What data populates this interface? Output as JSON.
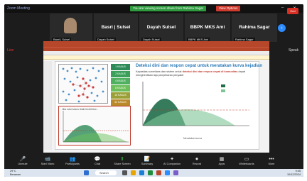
{
  "zoom": {
    "app_title": "Zoom Meeting",
    "share_banner": "You are viewing screen share from Rahima Sagar",
    "view_options": "View Options",
    "participants": [
      {
        "name": "Basri | Sulsel",
        "label": "Basri | Sulsel"
      },
      {
        "name": "Dayah Sulsel",
        "label": "Dayah Sulsel"
      },
      {
        "name": "BBPK MKS Ami",
        "label": "BBPK MKS Ami"
      },
      {
        "name": "Rahima Sagar",
        "label": "Rahima Sagar"
      }
    ],
    "side_labels": {
      "left": "Live",
      "right": "Speak"
    }
  },
  "presentation": {
    "headline": "Deteksi dini dan respon cepat untuk meratakan kurva kejadian",
    "subtext_pre": "Kapasitas surveilans dan sistem untuk ",
    "subtext_bold": "deteksi dini dan respon cepat di komunitas",
    "subtext_post": " dapat menghentikan laju penyebaran penyakit",
    "bars": [
      {
        "label": "1 KASUS",
        "color": "#2e8b57"
      },
      {
        "label": "2 KASUS",
        "color": "#3aa05a"
      },
      {
        "label": "4 KASUS",
        "color": "#4fb060"
      },
      {
        "label": "8 KASUS",
        "color": "#6cbf5a"
      },
      {
        "label": "16 KASUS",
        "color": "#9aa035"
      },
      {
        "label": "32 KASUS",
        "color": "#b9892a"
      },
      {
        "label": "64 KASUS",
        "color": "#c6622a"
      },
      {
        "label": "128 KASUS",
        "color": "#c03a2b"
      }
    ],
    "note_left": "Jika satu kasus tidak terdeteksi...",
    "note_bottom": "Meratakan kurva"
  },
  "controls": [
    {
      "icon": "mic-icon",
      "glyph": "🎤",
      "label": "Unmute"
    },
    {
      "icon": "video-icon",
      "glyph": "📹",
      "label": "Start Video"
    },
    {
      "icon": "participants-icon",
      "glyph": "👥",
      "label": "Participants"
    },
    {
      "icon": "chat-icon",
      "glyph": "💬",
      "label": "Chat"
    },
    {
      "icon": "share-icon",
      "glyph": "⬆",
      "label": "Share Screen"
    },
    {
      "icon": "summary-icon",
      "glyph": "📝",
      "label": "Summary"
    },
    {
      "icon": "companion-icon",
      "glyph": "✦",
      "label": "AI Companion"
    },
    {
      "icon": "record-icon",
      "glyph": "⏺",
      "label": "Record"
    },
    {
      "icon": "apps-icon",
      "glyph": "▦",
      "label": "Apps"
    },
    {
      "icon": "whiteboard-icon",
      "glyph": "▭",
      "label": "Whiteboards"
    },
    {
      "icon": "more-icon",
      "glyph": "•••",
      "label": "More"
    }
  ],
  "end_label": "End",
  "taskbar": {
    "search": "Search",
    "weather_temp": "29°C",
    "weather_desc": "Berawan",
    "time": "9:45",
    "date": "10/12/2024"
  }
}
